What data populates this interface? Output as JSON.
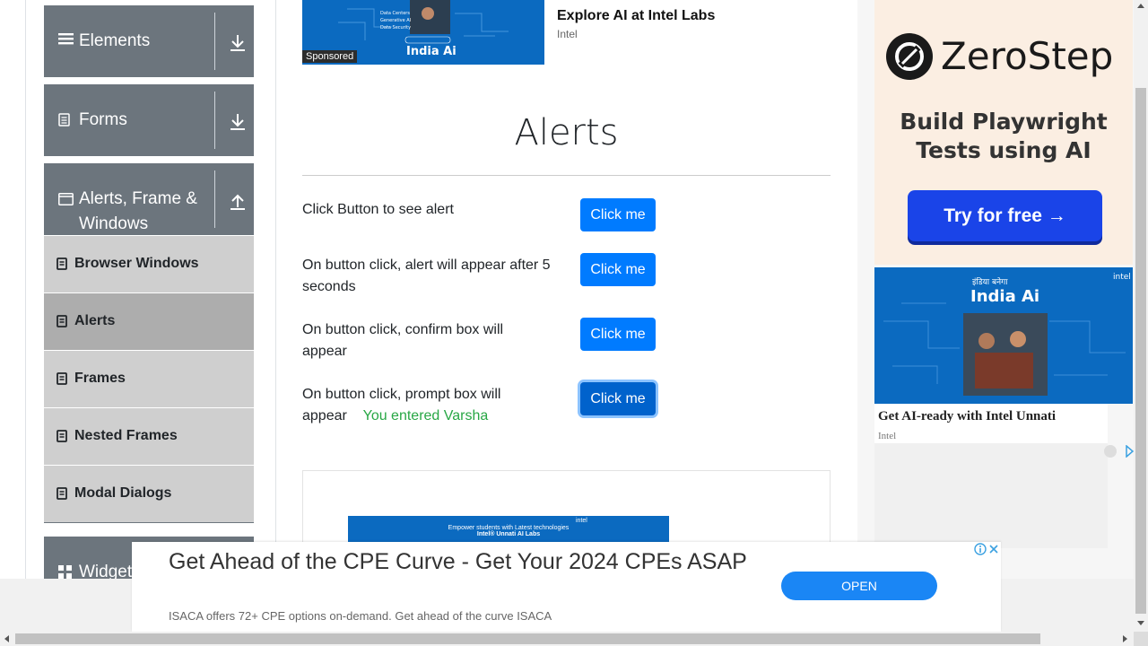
{
  "sidebar": {
    "groups": [
      {
        "label": "Elements",
        "icon": "list-icon",
        "arrow": "download-arrow-icon"
      },
      {
        "label": "Forms",
        "icon": "document-icon",
        "arrow": "download-arrow-icon"
      },
      {
        "label_line1": "Alerts, Frame &",
        "label_line2": "Windows",
        "icon": "window-icon",
        "arrow": "upload-arrow-icon"
      },
      {
        "label": "Widgets",
        "icon": "grid-icon"
      }
    ],
    "items": [
      {
        "label": "Browser Windows",
        "active": false
      },
      {
        "label": "Alerts",
        "active": true
      },
      {
        "label": "Frames",
        "active": false
      },
      {
        "label": "Nested Frames",
        "active": false
      },
      {
        "label": "Modal Dialogs",
        "active": false
      }
    ]
  },
  "top_ad": {
    "headline": "Explore AI at Intel Labs",
    "advertiser": "Intel",
    "badge": "Sponsored",
    "image_text": "India Ai"
  },
  "main": {
    "title": "Alerts",
    "rows": [
      {
        "text": "Click Button to see alert",
        "button": "Click me"
      },
      {
        "text": "On button click, alert will appear after 5 seconds",
        "button": "Click me"
      },
      {
        "text": "On button click, confirm box will appear",
        "button": "Click me"
      },
      {
        "text": "On button click, prompt box will appear",
        "button": "Click me",
        "result": "You entered Varsha"
      }
    ],
    "inner_ad_line1": "Empower students with Latest technologies",
    "inner_ad_line2": "Intel® Unnati AI Labs",
    "inner_ad_brand": "intel"
  },
  "right_ad": {
    "brand": "ZeroStep",
    "tagline_line1": "Build Playwright",
    "tagline_line2": "Tests using AI",
    "cta": "Try for free →"
  },
  "right_ad2": {
    "brand": "intel",
    "image_title": "India Ai",
    "image_hindi": "इंडिया बनेगा",
    "headline": "Get AI-ready with Intel Unnati",
    "advertiser": "Intel"
  },
  "bottom_ad": {
    "headline": "Get Ahead of the CPE Curve - Get Your 2024 CPEs ASAP",
    "description": "ISACA offers 72+ CPE options on-demand. Get ahead of the curve ISACA",
    "cta": "OPEN"
  },
  "colors": {
    "primary": "#007bff",
    "sidebar_group": "#6c757d",
    "sidebar_item": "#cfcfcf",
    "sidebar_item_active": "#adadad",
    "success": "#28a745",
    "intel_blue": "#0b6ac0",
    "zerostep_button": "#1a44e8"
  }
}
